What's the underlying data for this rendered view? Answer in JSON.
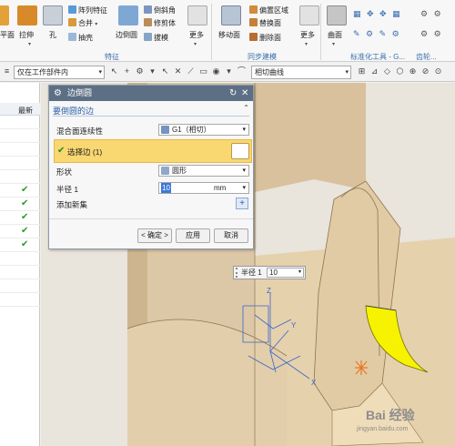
{
  "ribbon": {
    "left_partial": "平面",
    "items": {
      "pull": "拉伸",
      "hole": "孔",
      "array_feature": "阵列特征",
      "merge": "合并",
      "shell": "抽壳",
      "edge_blend": "边倒圆",
      "chamfer": "倒斜角",
      "trim_body": "修剪体",
      "draft": "拔模",
      "more1": "更多",
      "move_face": "移动面",
      "offset_region": "偏置区域",
      "replace_face": "替换面",
      "delete_face": "删除面",
      "more2": "更多",
      "surface": "曲面"
    },
    "groups": {
      "feature": "特征",
      "sync_modeling": "同步建模",
      "std_tools": "标准化工具 - G...",
      "gear": "齿轮..."
    }
  },
  "toolbar": {
    "scope_filter": "仅在工作部件内",
    "curve_rule": "相切曲线"
  },
  "nav": {
    "column_header": "最新",
    "check_glyph": "✔"
  },
  "dialog": {
    "title": "边倒圆",
    "section": "要倒圆的边",
    "continuity_label": "混合面连续性",
    "continuity_value": "G1（相切）",
    "select_edge": "选择边 (1)",
    "shape_label": "形状",
    "shape_value": "圆形",
    "radius_label": "半径 1",
    "radius_value": "10",
    "radius_unit": "mm",
    "add_new_set": "添加新集",
    "ok": "< 确定 >",
    "apply": "应用",
    "cancel": "取消"
  },
  "floating_input": {
    "label": "半径 1",
    "value": "10"
  },
  "axes": {
    "x": "X",
    "y": "Y",
    "z": "Z"
  },
  "watermark": {
    "text": "Bai 经验",
    "url": "jingyan.baidu.com"
  },
  "colors": {
    "dialog_title": "#5d6f84",
    "selection_row": "#f9d771",
    "model_body": "#dcc7a6",
    "highlighted_fillet": "#f7f200",
    "axis_blue": "#3a66c8",
    "accent_blue": "#2a5fa8"
  }
}
